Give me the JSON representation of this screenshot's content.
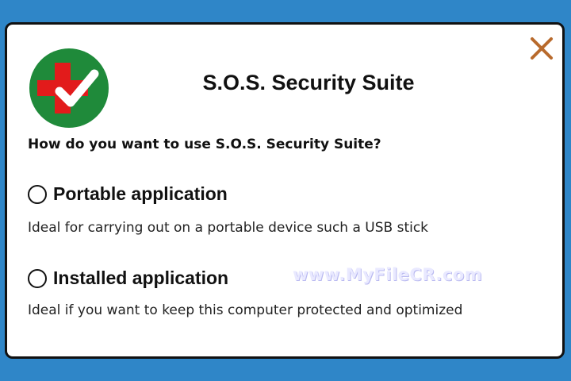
{
  "app": {
    "title": "S.O.S. Security Suite",
    "question": "How do you want to use S.O.S. Security Suite?"
  },
  "options": [
    {
      "label": "Portable application",
      "description": "Ideal for carrying out on a portable device such a USB stick",
      "selected": false
    },
    {
      "label": "Installed application",
      "description": "Ideal if you want to keep this computer protected and optimized",
      "selected": false
    }
  ],
  "watermark": "www.MyFileCR.com",
  "icons": {
    "close": "close-icon",
    "logo": "red-cross-checkmark-logo"
  },
  "colors": {
    "background": "#2f86c8",
    "close": "#b86a2c",
    "logo_green": "#1f8a3a",
    "logo_red": "#e21b1b"
  }
}
